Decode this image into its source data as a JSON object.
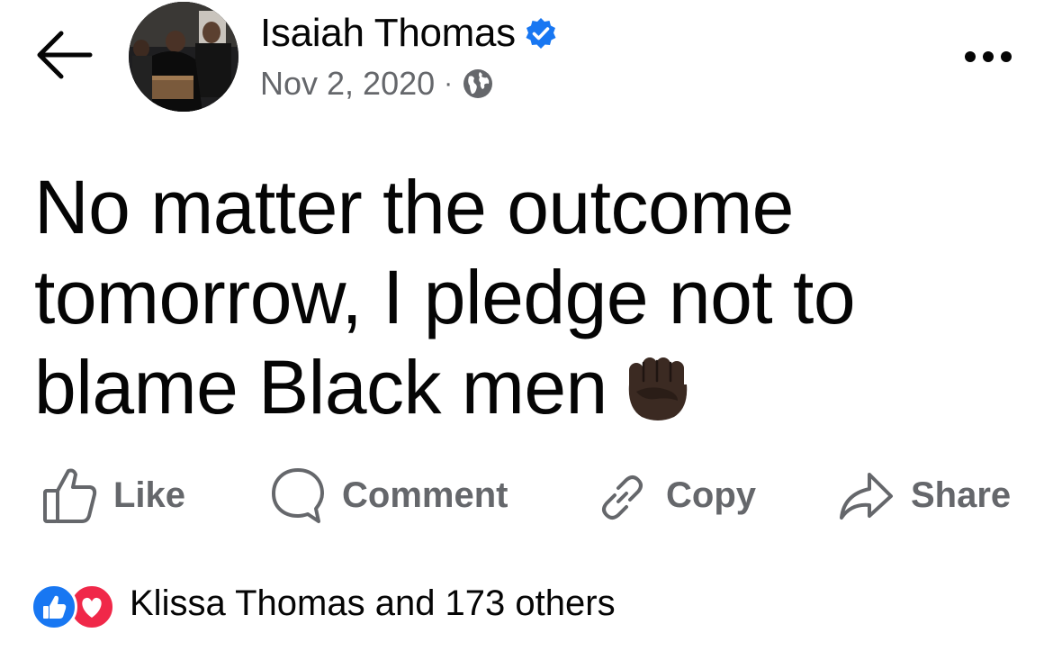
{
  "header": {
    "back_icon": "arrow-left-icon",
    "author_name": "Isaiah Thomas",
    "verified_icon": "verified-badge-icon",
    "date": "Nov 2, 2020",
    "separator": "·",
    "privacy_icon": "globe-icon",
    "more_icon": "more-horizontal-icon"
  },
  "post": {
    "text": "No matter the outcome tomorrow, I pledge not to blame Black men",
    "emoji_icon": "raised-fist-icon"
  },
  "actions": {
    "like_label": "Like",
    "comment_label": "Comment",
    "copy_label": "Copy",
    "share_label": "Share"
  },
  "reactions": {
    "icons": [
      "like-reaction-icon",
      "love-reaction-icon"
    ],
    "summary": "Klissa Thomas and 173 others"
  },
  "colors": {
    "text_primary": "#050505",
    "text_secondary": "#65676b",
    "verified_blue": "#1877f2",
    "like_blue": "#1877f2",
    "love_red": "#f02849"
  }
}
